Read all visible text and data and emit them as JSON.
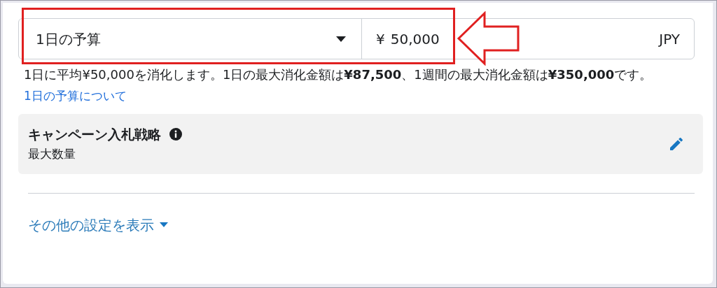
{
  "budget": {
    "type_dropdown": {
      "value": "1日の予算"
    },
    "amount": {
      "currency_symbol": "¥",
      "value": "50,000"
    },
    "currency": "JPY"
  },
  "description": "1日に平均¥50,000を消化します。1日の最大消化金額は**¥87,500**、1週間の最大消化金額は**¥350,000**です。",
  "help_link": "1日の予算について",
  "bid_strategy": {
    "title": "キャンペーン入札戦略",
    "value": "最大数量"
  },
  "more_settings_link": "その他の設定を表示"
}
